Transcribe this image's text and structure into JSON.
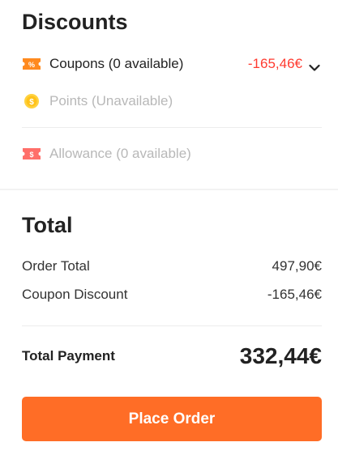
{
  "discounts": {
    "title": "Discounts",
    "coupons": {
      "label": "Coupons (0 available)",
      "amount": "-165,46€",
      "icon": "coupon-icon"
    },
    "points": {
      "label": "Points (Unavailable)",
      "icon": "coin-icon"
    },
    "allowance": {
      "label": "Allowance (0 available)",
      "icon": "allowance-icon"
    }
  },
  "total": {
    "title": "Total",
    "order_total_label": "Order Total",
    "order_total_value": "497,90€",
    "coupon_discount_label": "Coupon Discount",
    "coupon_discount_value": "-165,46€",
    "payment_label": "Total Payment",
    "payment_value": "332,44€"
  },
  "actions": {
    "place_order_label": "Place Order"
  },
  "colors": {
    "accent": "#ff6d26",
    "discount_red": "#ff3b30",
    "disabled_text": "#b8b8b8"
  }
}
